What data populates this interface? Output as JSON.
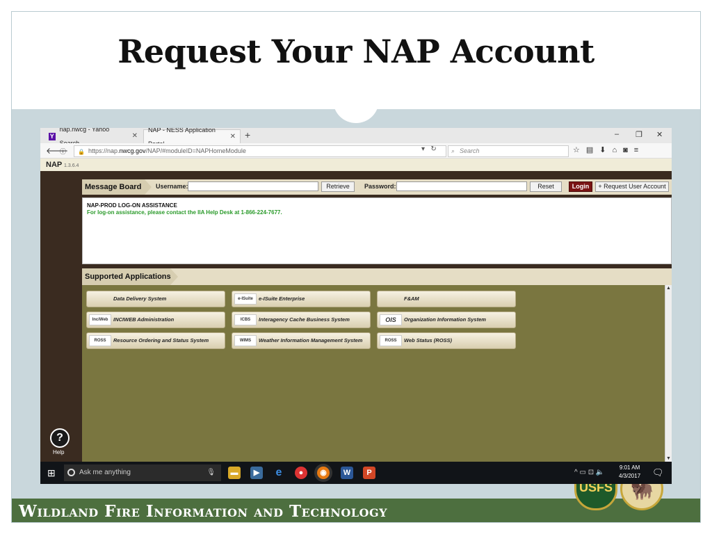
{
  "slide": {
    "title": "Request Your NAP Account",
    "footer": "Wildland Fire Information and Technology",
    "badge_forest": "USFS"
  },
  "browser": {
    "tabs": [
      {
        "label": "nap.nwcg - Yahoo Search ...",
        "icon": "yahoo-icon"
      },
      {
        "label": "NAP - NESS Application Portal",
        "icon": "none"
      }
    ],
    "url_prefix": "https://nap.",
    "url_domain": "nwcg.gov",
    "url_path": "/NAP/#moduleID=NAPHomeModule",
    "search_placeholder": "Search",
    "window_controls": [
      "–",
      "❐",
      "✕"
    ]
  },
  "nap": {
    "name": "NAP",
    "version": "1.3.6.4",
    "message_board": "Message Board",
    "username_label": "Username:",
    "retrieve": "Retrieve",
    "password_label": "Password:",
    "reset": "Reset",
    "login": "Login",
    "request_account": "+ Request User Account",
    "msg_heading": "NAP-PROD LOG-ON ASSISTANCE",
    "msg_body": "For log-on assistance, please contact the IIA Help Desk at 1-866-224-7677.",
    "supported_apps": "Supported Applications",
    "help": "Help",
    "apps": [
      {
        "label": "Data Delivery System",
        "logo": ""
      },
      {
        "label": "e-ISuite Enterprise",
        "logo": "e-ISuite"
      },
      {
        "label": "F&AM",
        "logo": ""
      },
      {
        "label": "INCIWEB Administration",
        "logo": "InciWeb"
      },
      {
        "label": "Interagency Cache Business System",
        "logo": "ICBS"
      },
      {
        "label": "Organization Information System",
        "logo": "OIS"
      },
      {
        "label": "Resource Ordering and Status System",
        "logo": "ROSS"
      },
      {
        "label": "Weather Information Management System",
        "logo": "WIMS"
      },
      {
        "label": "Web Status (ROSS)",
        "logo": "ROSS"
      }
    ]
  },
  "taskbar": {
    "search_placeholder": "Ask me anything",
    "time": "9:01 AM",
    "date": "4/3/2017"
  }
}
